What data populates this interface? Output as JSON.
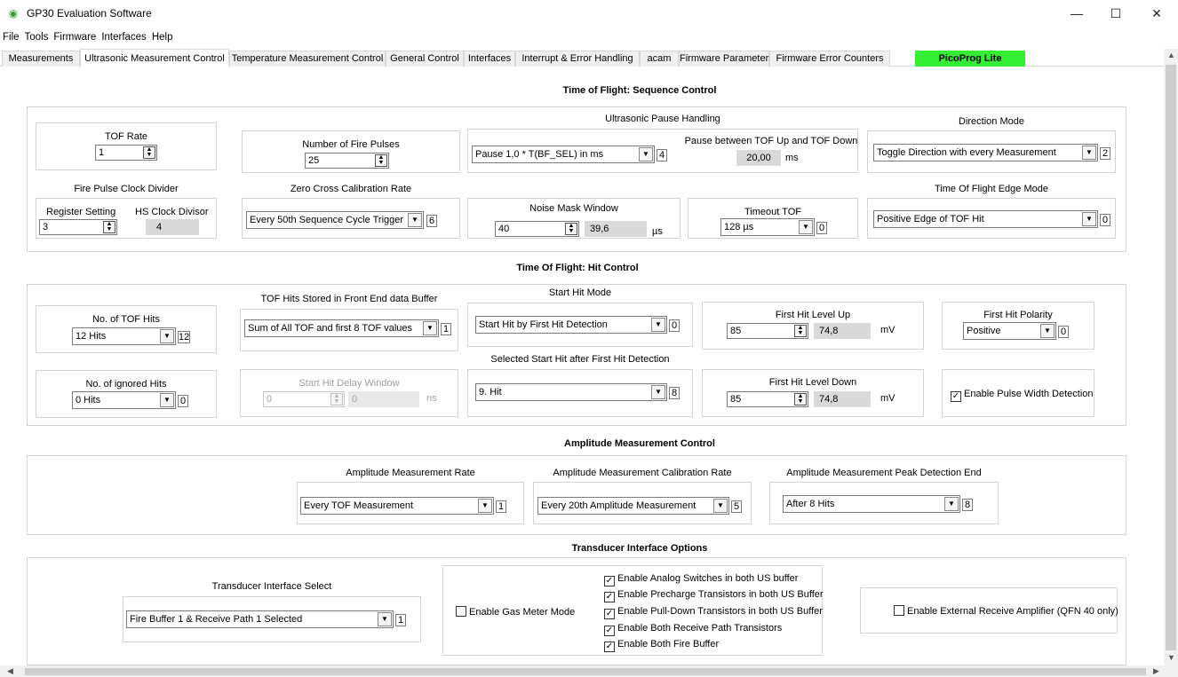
{
  "window": {
    "title": "GP30 Evaluation Software",
    "minimize": "—",
    "maximize": "☐",
    "close": "✕"
  },
  "menu": [
    "File",
    "Tools",
    "Firmware",
    "Interfaces",
    "Help"
  ],
  "tabs": [
    "Measurements",
    "Ultrasonic Measurement Control",
    "Temperature Measurement Control",
    "General Control",
    "Interfaces",
    "Interrupt & Error Handling",
    "acam",
    "Firmware Parameters",
    "Firmware Error Counters",
    "PicoProg Lite"
  ],
  "seq": {
    "title": "Time of Flight: Sequence Control",
    "tof_rate_label": "TOF Rate",
    "tof_rate": "1",
    "fire_pulses_label": "Number of Fire Pulses",
    "fire_pulses": "25",
    "pause_handling_label": "Ultrasonic Pause Handling",
    "pause_mode": "Pause 1,0 * T(BF_SEL) in ms",
    "pause_mode_idx": "4",
    "pause_between_label": "Pause between TOF Up and TOF Down",
    "pause_between": "20,00",
    "pause_unit": "ms",
    "direction_label": "Direction Mode",
    "direction": "Toggle Direction with every Measurement",
    "direction_idx": "2",
    "fire_clock_label": "Fire Pulse Clock Divider",
    "register_setting_label": "Register Setting",
    "register_setting": "3",
    "hs_clock_label": "HS Clock Divisor",
    "hs_clock": "4",
    "zero_cross_label": "Zero Cross Calibration Rate",
    "zero_cross": "Every 50th Sequence Cycle Trigger",
    "zero_cross_idx": "6",
    "noise_mask_label": "Noise Mask Window",
    "noise_mask": "40",
    "noise_mask_calc": "39,6",
    "noise_mask_unit": "µs",
    "timeout_label": "Timeout TOF",
    "timeout": "128 µs",
    "timeout_idx": "0",
    "edge_label": "Time Of Flight Edge Mode",
    "edge": "Positive Edge of TOF Hit",
    "edge_idx": "0"
  },
  "hit": {
    "title": "Time Of Flight: Hit Control",
    "num_hits_label": "No. of TOF Hits",
    "num_hits": "12 Hits",
    "num_hits_idx": "12",
    "stored_label": "TOF Hits Stored in Front End data Buffer",
    "stored": "Sum of All TOF and first 8 TOF values",
    "stored_idx": "1",
    "start_mode_label": "Start Hit Mode",
    "start_mode": "Start Hit by First Hit Detection",
    "start_mode_idx": "0",
    "level_up_label": "First Hit Level Up",
    "level_up": "85",
    "level_up_calc": "74,8",
    "level_unit": "mV",
    "polarity_label": "First Hit Polarity",
    "polarity": "Positive",
    "polarity_idx": "0",
    "ignored_label": "No. of ignored Hits",
    "ignored": "0 Hits",
    "ignored_idx": "0",
    "delay_label": "Start Hit Delay Window",
    "delay": "0",
    "delay_calc": "0",
    "delay_unit": "ns",
    "selected_label": "Selected Start Hit after First Hit Detection",
    "selected": "9. Hit",
    "selected_idx": "8",
    "level_down_label": "First Hit Level Down",
    "level_down": "85",
    "level_down_calc": "74,8",
    "pulse_width": "Enable Pulse Width Detection"
  },
  "amp": {
    "title": "Amplitude Measurement Control",
    "rate_label": "Amplitude Measurement Rate",
    "rate": "Every TOF Measurement",
    "rate_idx": "1",
    "cal_label": "Amplitude Measurement Calibration Rate",
    "cal": "Every 20th Amplitude Measurement",
    "cal_idx": "5",
    "peak_label": "Amplitude Measurement Peak Detection End",
    "peak": "After 8 Hits",
    "peak_idx": "8"
  },
  "trans": {
    "title": "Transducer Interface Options",
    "select_label": "Transducer Interface Select",
    "select": "Fire Buffer 1 & Receive Path 1 Selected",
    "select_idx": "1",
    "gas_meter": "Enable Gas Meter Mode",
    "options": [
      "Enable Analog Switches in both US buffer",
      "Enable Precharge Transistors in both US Buffer",
      "Enable Pull-Down Transistors in both US Buffer",
      "Enable Both Receive Path Transistors",
      "Enable Both Fire Buffer"
    ],
    "ext_amp": "Enable External Receive Amplifier (QFN 40 only)"
  }
}
